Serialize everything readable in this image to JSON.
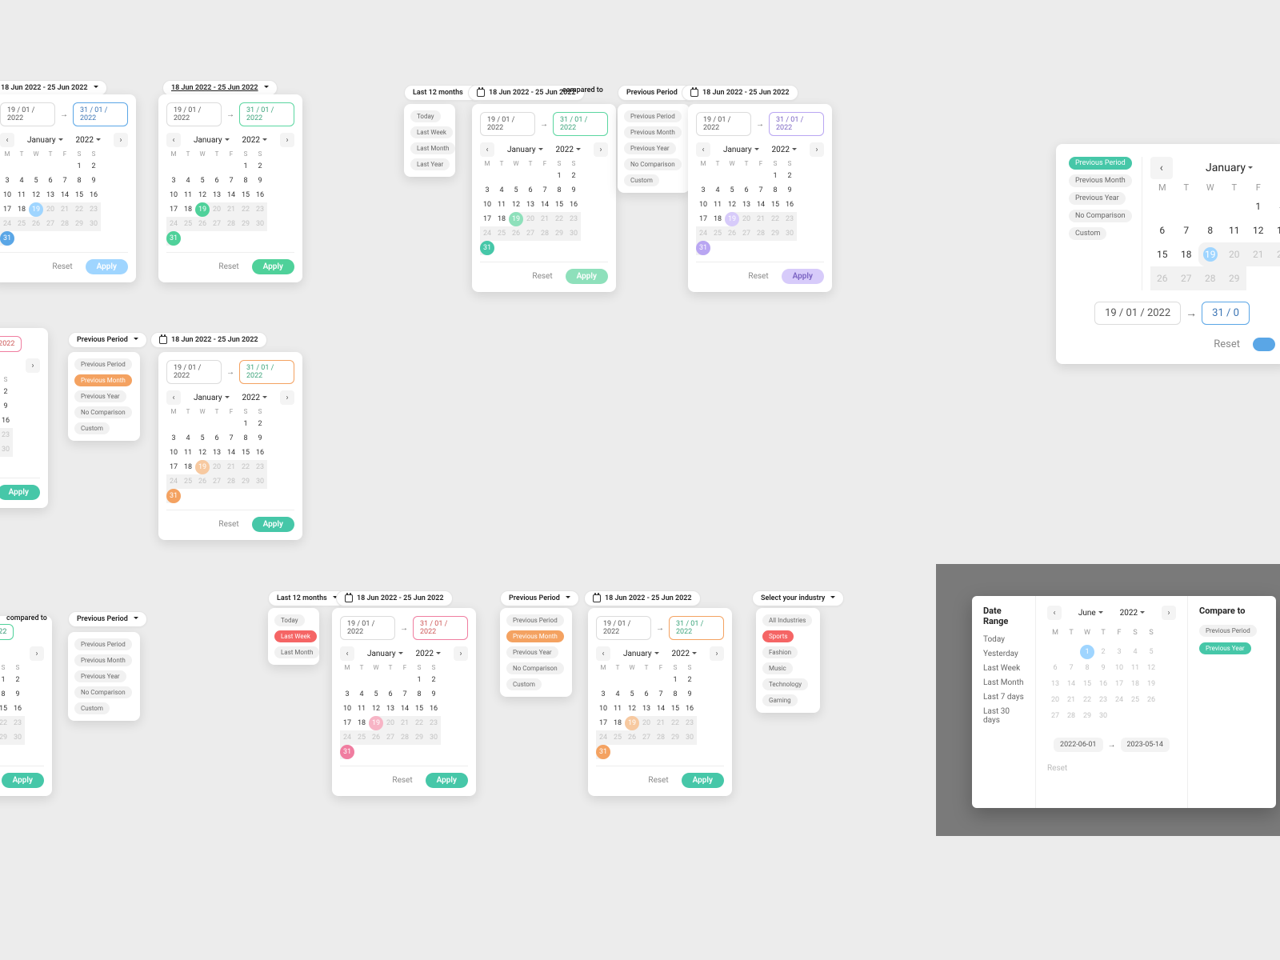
{
  "common": {
    "date_range_label": "18 Jun 2022 - 25 Jun 2022",
    "compared_to": "compared to",
    "previous_period": "Previous Period",
    "last12": "Last 12 months",
    "select_industry": "Select your industry",
    "start_date": "19 / 01 / 2022",
    "end_date": "31 / 01 / 2022",
    "month": "January",
    "year": "2022",
    "dow": [
      "M",
      "T",
      "W",
      "T",
      "F",
      "S",
      "S"
    ],
    "reset": "Reset",
    "apply": "Apply"
  },
  "weeks": [
    [
      "",
      "",
      "",
      "",
      "",
      "1",
      "2"
    ],
    [
      "3",
      "4",
      "5",
      "6",
      "7",
      "8",
      "9"
    ],
    [
      "10",
      "11",
      "12",
      "13",
      "14",
      "15",
      "16"
    ],
    [
      "17",
      "18",
      "19",
      "20",
      "21",
      "22",
      "23"
    ],
    [
      "24",
      "25",
      "26",
      "27",
      "28",
      "29",
      "30"
    ],
    [
      "31",
      "",
      "",
      "",
      "",
      "",
      ""
    ]
  ],
  "prevOptions": {
    "period": "Previous Period",
    "month": "Previous Month",
    "year": "Previous Year",
    "none": "No Comparison",
    "custom": "Custom"
  },
  "timeOptions": {
    "today": "Today",
    "lastWeek": "Last Week",
    "lastMonth": "Last Month",
    "lastYear": "Last Year"
  },
  "timeOptions2": {
    "today": "Today",
    "yesterday": "Yesterday",
    "lastWeek": "Last Week",
    "lastMonth": "Last Month",
    "last7": "Last 7 days",
    "last30": "Last 30 days"
  },
  "industries": {
    "all": "All Industries",
    "sports": "Sports",
    "fashion": "Fashion",
    "music": "Music",
    "tech": "Technology",
    "gaming": "Gaming"
  },
  "mock": {
    "dateRange": "Date Range",
    "compareTo": "Compare to",
    "month": "June",
    "year": "2022",
    "start": "2022-06-01",
    "end": "2023-05-14",
    "reset": "Reset",
    "pp": "Previous Period",
    "py": "Previous Year"
  }
}
